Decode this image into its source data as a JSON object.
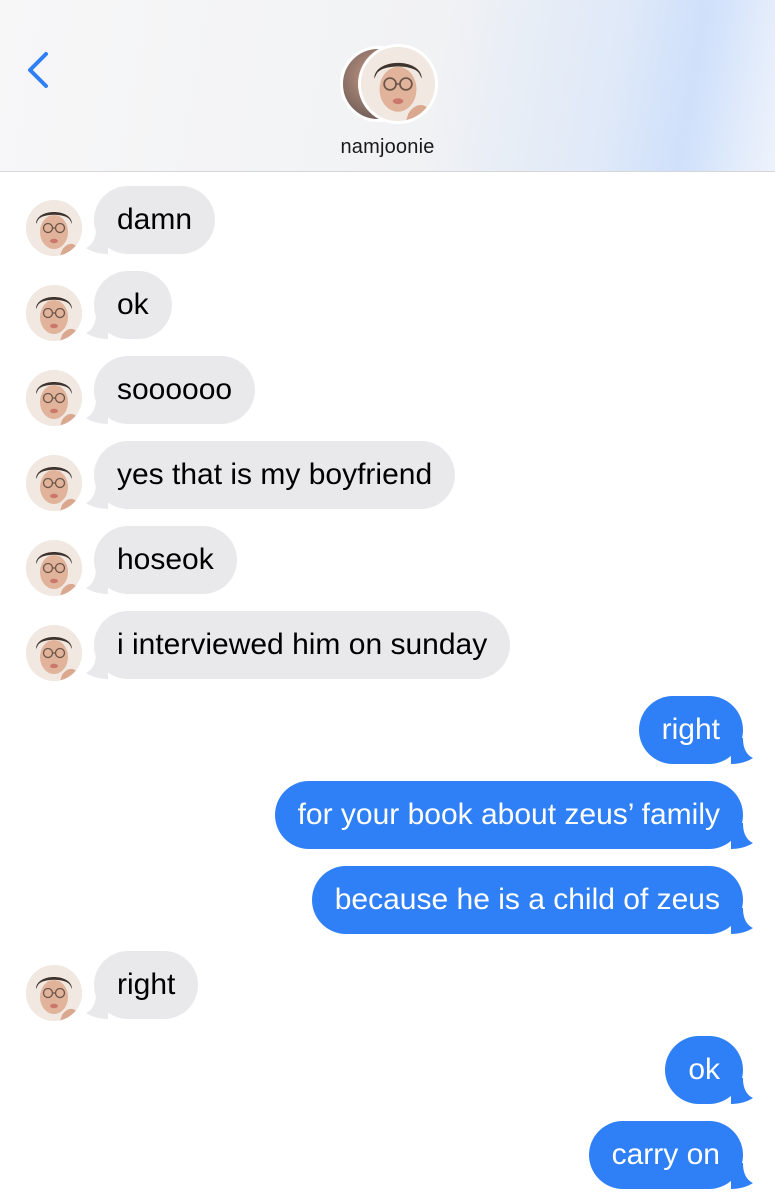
{
  "header": {
    "contact_name": "namjoonie",
    "back_icon": "chevron-left-icon",
    "accent_color": "#2f7ff6"
  },
  "messages": [
    {
      "direction": "incoming",
      "text": "damn"
    },
    {
      "direction": "incoming",
      "text": "ok"
    },
    {
      "direction": "incoming",
      "text": "soooooo"
    },
    {
      "direction": "incoming",
      "text": "yes that is my boyfriend"
    },
    {
      "direction": "incoming",
      "text": "hoseok"
    },
    {
      "direction": "incoming",
      "text": "i interviewed him on sunday"
    },
    {
      "direction": "outgoing",
      "text": "right"
    },
    {
      "direction": "outgoing",
      "text": "for your book about zeus’ family"
    },
    {
      "direction": "outgoing",
      "text": "because he is a child of zeus"
    },
    {
      "direction": "incoming",
      "text": "right"
    },
    {
      "direction": "outgoing",
      "text": "ok"
    },
    {
      "direction": "outgoing",
      "text": "carry on"
    }
  ],
  "colors": {
    "incoming_bubble": "#e9e9eb",
    "outgoing_bubble": "#2f7ff6"
  }
}
